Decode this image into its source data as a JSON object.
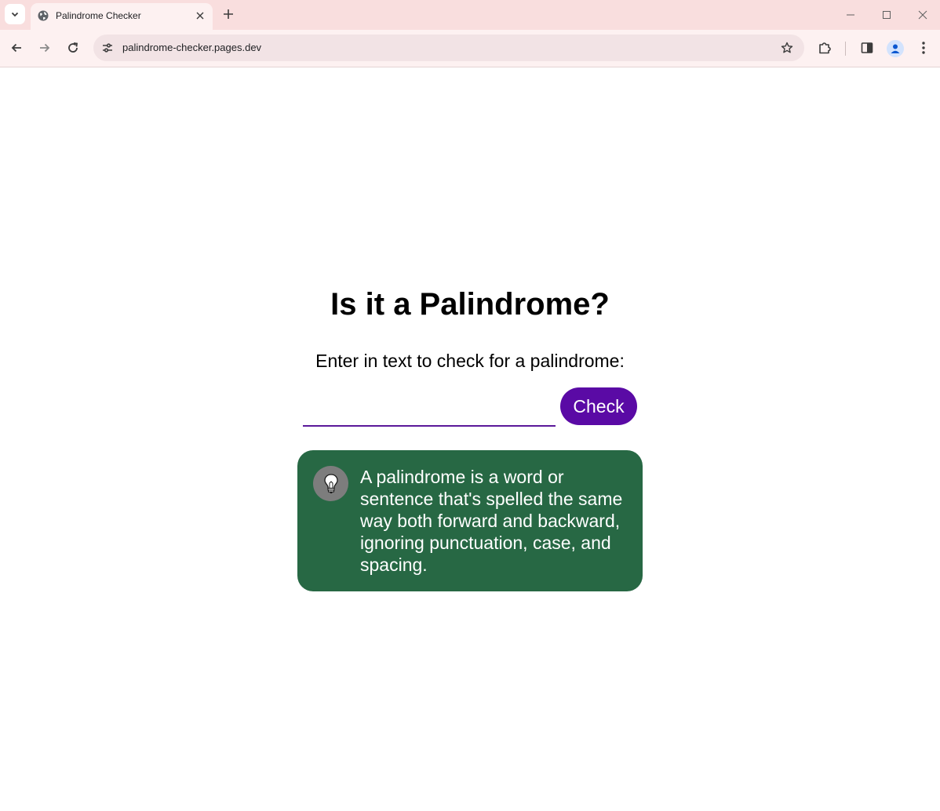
{
  "browser": {
    "tab": {
      "title": "Palindrome Checker"
    },
    "address_bar": {
      "url": "palindrome-checker.pages.dev"
    },
    "icons": {
      "tab_search": "chevron-down-icon",
      "favicon": "globe-icon",
      "tab_close": "close-icon",
      "new_tab": "plus-icon",
      "back": "arrow-left-icon",
      "forward": "arrow-right-icon",
      "reload": "reload-icon",
      "site_info": "tune-icon",
      "bookmark": "star-icon",
      "extensions": "puzzle-icon",
      "side_panel": "side-panel-icon",
      "profile": "person-icon",
      "menu": "kebab-menu-icon",
      "minimize": "minimize-icon",
      "maximize": "maximize-icon",
      "window_close": "close-icon"
    }
  },
  "page": {
    "title": "Is it a Palindrome?",
    "prompt": "Enter in text to check for a palindrome:",
    "input": {
      "value": "",
      "placeholder": ""
    },
    "check_button": "Check",
    "info": {
      "icon": "lightbulb-icon",
      "text": "A palindrome is a word or sentence that's spelled the same way both forward and backward, ignoring punctuation, case, and spacing."
    }
  },
  "colors": {
    "tabbar_bg": "#f9dede",
    "toolbar_bg": "#fdf1f1",
    "omnibox_bg": "#f2e3e5",
    "button_purple": "#5a0aa5",
    "input_underline": "#5a189a",
    "info_box_green": "#276844",
    "bulb_circle": "#7d7d7d"
  }
}
